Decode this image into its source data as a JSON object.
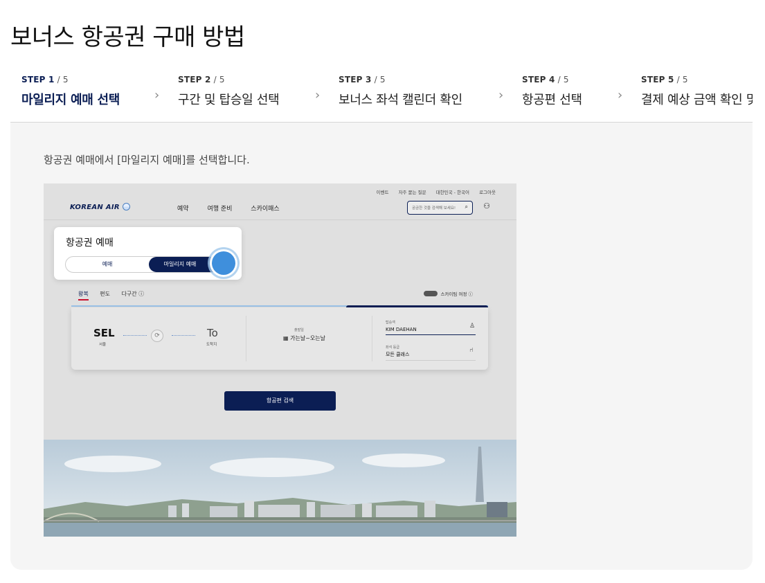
{
  "page": {
    "title": "보너스 항공권 구매 방법"
  },
  "steps": [
    {
      "num": "STEP 1",
      "total": " / 5",
      "title": "마일리지 예매 선택",
      "active": true
    },
    {
      "num": "STEP 2",
      "total": " / 5",
      "title": "구간 및 탑승일 선택",
      "active": false
    },
    {
      "num": "STEP 3",
      "total": " / 5",
      "title": "보너스 좌석 캘린더 확인",
      "active": false
    },
    {
      "num": "STEP 4",
      "total": " / 5",
      "title": "항공편 선택",
      "active": false
    },
    {
      "num": "STEP 5",
      "total": " / 5",
      "title": "결제 예상 금액 확인 및",
      "active": false
    }
  ],
  "panel": {
    "description": "항공권 예매에서 [마일리지 예매]를 선택합니다."
  },
  "screenshot": {
    "util_links": [
      "이벤트",
      "자주 묻는 질문",
      "대한민국 - 한국어",
      "로그아웃"
    ],
    "logo": "KOREAN AIR",
    "nav": [
      "예약",
      "여행 준비",
      "스카이패스"
    ],
    "search_placeholder": "궁금한 것을 검색해 보세요!",
    "booking_card": {
      "title": "항공권 예매",
      "option_normal": "예매",
      "option_mileage": "마일리지 예매"
    },
    "trip_tabs": [
      "왕복",
      "편도",
      "다구간 ⓘ"
    ],
    "skypass_toggle": "스카이팀 여정 ⓘ",
    "origin_code": "SEL",
    "origin_city": "서울",
    "destination_code": "To",
    "destination_city": "도착지",
    "date_label": "출발일",
    "date_value": "가는날~오는날",
    "passenger_label": "탑승객",
    "passenger_value": "KIM DAEHAN",
    "class_label": "좌석 등급",
    "class_value": "모든 클래스",
    "search_button": "항공편 검색"
  },
  "colors": {
    "navy": "#0b1e54",
    "tap": "#3f8fdc",
    "panel_bg": "#f5f5f5"
  }
}
